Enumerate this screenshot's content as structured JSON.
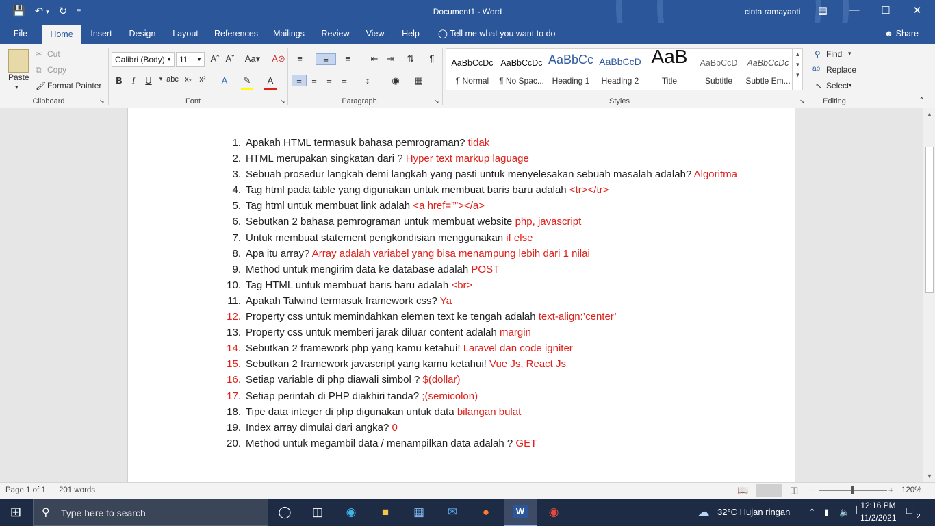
{
  "window": {
    "title": "Document1  -  Word",
    "user": "cinta ramayanti"
  },
  "menu": {
    "tabs": [
      "File",
      "Home",
      "Insert",
      "Design",
      "Layout",
      "References",
      "Mailings",
      "Review",
      "View",
      "Help"
    ],
    "tell_me": "Tell me what you want to do",
    "share": "Share"
  },
  "ribbon": {
    "clipboard": {
      "paste": "Paste",
      "cut": "Cut",
      "copy": "Copy",
      "format_painter": "Format Painter",
      "label": "Clipboard"
    },
    "font": {
      "family": "Calibri (Body)",
      "size": "11",
      "label": "Font"
    },
    "paragraph": {
      "label": "Paragraph"
    },
    "styles": {
      "label": "Styles",
      "items": [
        {
          "preview": "AaBbCcDc",
          "name": "¶ Normal"
        },
        {
          "preview": "AaBbCcDc",
          "name": "¶ No Spac..."
        },
        {
          "preview": "AaBbCc",
          "name": "Heading 1"
        },
        {
          "preview": "AaBbCcD",
          "name": "Heading 2"
        },
        {
          "preview": "AaB",
          "name": "Title"
        },
        {
          "preview": "AaBbCcD",
          "name": "Subtitle"
        },
        {
          "preview": "AaBbCcDc",
          "name": "Subtle Em..."
        }
      ]
    },
    "editing": {
      "find": "Find",
      "replace": "Replace",
      "select": "Select",
      "label": "Editing"
    }
  },
  "document": {
    "items": [
      {
        "num": "1.",
        "q": "Apakah HTML termasuk bahasa pemrograman? ",
        "a": "tidak"
      },
      {
        "num": "2.",
        "q": "HTML merupakan singkatan dari ? ",
        "a": "Hyper text markup laguage"
      },
      {
        "num": "3.",
        "q": "Sebuah prosedur langkah demi langkah yang pasti untuk menyelesakan sebuah masalah adalah? ",
        "a": "Algoritma"
      },
      {
        "num": "4.",
        "q": "Tag html pada table yang digunakan untuk membuat baris baru adalah ",
        "a": "<tr></tr>"
      },
      {
        "num": "5.",
        "q": "Tag html untuk membuat link adalah ",
        "a": "<a href=””></a>"
      },
      {
        "num": "6.",
        "q": "Sebutkan 2 bahasa pemrograman untuk membuat website ",
        "a": "php, javascript"
      },
      {
        "num": "7.",
        "q": "Untuk membuat statement pengkondisian menggunakan ",
        "a": "if else"
      },
      {
        "num": "8.",
        "q": "Apa itu array? ",
        "a": "Array adalah variabel yang bisa menampung lebih dari 1 nilai"
      },
      {
        "num": "9.",
        "q": "Method untuk mengirim data ke database adalah ",
        "a": "POST"
      },
      {
        "num": "10.",
        "q": "Tag HTML untuk membuat baris baru adalah ",
        "a": "<br>"
      },
      {
        "num": "11.",
        "q": "Apakah Talwind termasuk framework css? ",
        "a": "Ya"
      },
      {
        "num": "12.",
        "q": "Property css untuk memindahkan elemen text ke tengah adalah ",
        "a": "text-align:’center’",
        "red_num": true
      },
      {
        "num": "13.",
        "q": "Property css untuk memberi jarak diluar content adalah ",
        "a": "margin"
      },
      {
        "num": "14.",
        "q": "Sebutkan 2 framework php yang kamu ketahui! ",
        "a": "Laravel dan code igniter",
        "red_num": true
      },
      {
        "num": "15.",
        "q": "Sebutkan 2 framework javascript yang kamu ketahui! ",
        "a": "Vue Js, React Js",
        "red_num": true
      },
      {
        "num": "16.",
        "q": "Setiap variable di php diawali simbol ? ",
        "a": "$(dollar)",
        "red_num": true
      },
      {
        "num": "17.",
        "q": "Setiap perintah di PHP diakhiri tanda? ",
        "a": ";(semicolon)",
        "red_num": true
      },
      {
        "num": "18.",
        "q": "Tipe data integer di php digunakan untuk data ",
        "a": "bilangan bulat"
      },
      {
        "num": "19.",
        "q": "Index array dimulai dari angka? ",
        "a": "0"
      },
      {
        "num": "20.",
        "q": "Method untuk megambil data / menampilkan data adalah ? ",
        "a": "GET"
      }
    ]
  },
  "status": {
    "page": "Page 1 of 1",
    "words": "201 words",
    "zoom": "120%"
  },
  "taskbar": {
    "search_placeholder": "Type here to search",
    "weather": "32°C  Hujan ringan",
    "time": "12:16 PM",
    "date": "11/2/2021",
    "notifications": "2"
  },
  "colors": {
    "word_blue": "#2b579a",
    "answer_red": "#e0201a",
    "taskbar": "#1d2b44"
  }
}
